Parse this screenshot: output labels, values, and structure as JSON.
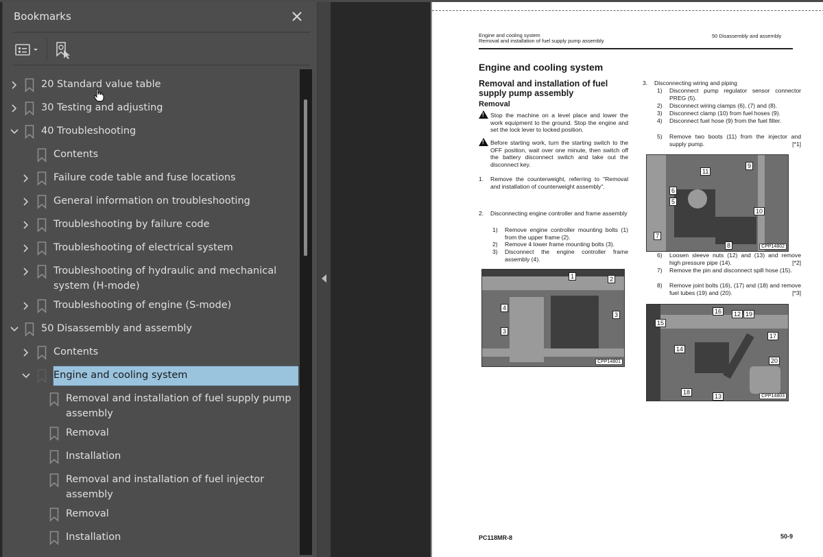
{
  "panel": {
    "title": "Bookmarks",
    "close_icon": "close-icon",
    "toolbar": {
      "options_icon": "list-options-icon",
      "find_current_icon": "find-current-bookmark-icon"
    }
  },
  "bookmarks": [
    {
      "label": "20 Standard value table",
      "level": 0,
      "expander": "collapsed"
    },
    {
      "label": "30 Testing and adjusting",
      "level": 0,
      "expander": "collapsed"
    },
    {
      "label": "40 Troubleshooting",
      "level": 0,
      "expander": "expanded"
    },
    {
      "label": "Contents",
      "level": 1,
      "expander": "none"
    },
    {
      "label": "Failure code table and fuse locations",
      "level": 1,
      "expander": "collapsed"
    },
    {
      "label": "General information on troubleshooting",
      "level": 1,
      "expander": "collapsed"
    },
    {
      "label": "Troubleshooting by failure code",
      "level": 1,
      "expander": "collapsed"
    },
    {
      "label": "Troubleshooting of electrical system",
      "level": 1,
      "expander": "collapsed"
    },
    {
      "label": "Troubleshooting of hydraulic and mechanical system (H-mode)",
      "level": 1,
      "expander": "collapsed"
    },
    {
      "label": "Troubleshooting of engine (S-mode)",
      "level": 1,
      "expander": "collapsed"
    },
    {
      "label": "50 Disassembly and assembly",
      "level": 0,
      "expander": "expanded"
    },
    {
      "label": "Contents",
      "level": 1,
      "expander": "collapsed"
    },
    {
      "label": "Engine and cooling system",
      "level": 1,
      "expander": "expanded",
      "selected": true
    },
    {
      "label": "Removal and installation of fuel supply pump assembly",
      "level": 2,
      "expander": "none"
    },
    {
      "label": "Removal",
      "level": 2,
      "expander": "none"
    },
    {
      "label": "Installation",
      "level": 2,
      "expander": "none"
    },
    {
      "label": "Removal and installation of fuel injector assembly",
      "level": 2,
      "expander": "none"
    },
    {
      "label": "Removal",
      "level": 2,
      "expander": "none"
    },
    {
      "label": "Installation",
      "level": 2,
      "expander": "none"
    }
  ],
  "page": {
    "header_left_1": "Engine and cooling system",
    "header_left_2": "Removal and installation of fuel supply pump assembly",
    "header_right": "50 Disassembly and assembly",
    "title": "Engine and cooling system",
    "subtitle": "Removal and installation of fuel supply pump assembly",
    "section": "Removal",
    "warnings": [
      "Stop the machine on a level place and lower the work equipment to the ground. Stop the engine and set the lock lever to locked position.",
      "Before starting work, turn the starting switch to the OFF position, wait over one minute, then switch off the battery disconnect switch and take out the disconnect key."
    ],
    "step1_num": "1.",
    "step1": "Remove the counterweight, referring to \"Removal and installation of counterweight assembly\".",
    "step2_num": "2.",
    "step2": "Disconnecting engine controller and frame assembly",
    "step2_sub": [
      {
        "n": "1)",
        "t": "Remove engine controller mounting bolts (1) from the upper frame (2)."
      },
      {
        "n": "2)",
        "t": "Remove 4 lower frame mounting bolts (3)."
      },
      {
        "n": "3)",
        "t": "Disconnect the engine controller frame assembly (4)."
      }
    ],
    "step3_num": "3.",
    "step3": "Disconnecting wiring and piping",
    "step3_sub": [
      {
        "n": "1)",
        "t": "Disconnect pump regulator sensor connector PREG (5)."
      },
      {
        "n": "2)",
        "t": "Disconnect wiring clamps (6), (7) and (8)."
      },
      {
        "n": "3)",
        "t": "Disconnect clamp (10) from fuel hoses (9)."
      },
      {
        "n": "4)",
        "t": "Disconnect fuel hose (9) from the fuel filter."
      },
      {
        "n": "5)",
        "t": "Remove two boots (11) from the injector and supply pump.",
        "ref": "[*1]"
      },
      {
        "n": "6)",
        "t": "Loosen sleeve nuts (12) and (13) and remove high pressure pipe (14).",
        "ref": "[*2]"
      },
      {
        "n": "7)",
        "t": "Remove the pin and disconnect spill hose (15)."
      },
      {
        "n": "8)",
        "t": "Remove joint bolts (16), (17) and (18) and remove fuel tubes (19) and (20).",
        "ref": "[*3]"
      }
    ],
    "figures": [
      {
        "code": "CPP14801",
        "callouts": [
          "1",
          "2",
          "3",
          "4",
          "3"
        ]
      },
      {
        "code": "CPP14802",
        "callouts": [
          "11",
          "9",
          "6",
          "5",
          "10",
          "7",
          "8"
        ]
      },
      {
        "code": "CPP14803",
        "callouts": [
          "16",
          "12",
          "19",
          "15",
          "17",
          "14",
          "20",
          "18",
          "13"
        ]
      }
    ],
    "footer_left": "PC118MR-8",
    "footer_right": "50-9"
  }
}
